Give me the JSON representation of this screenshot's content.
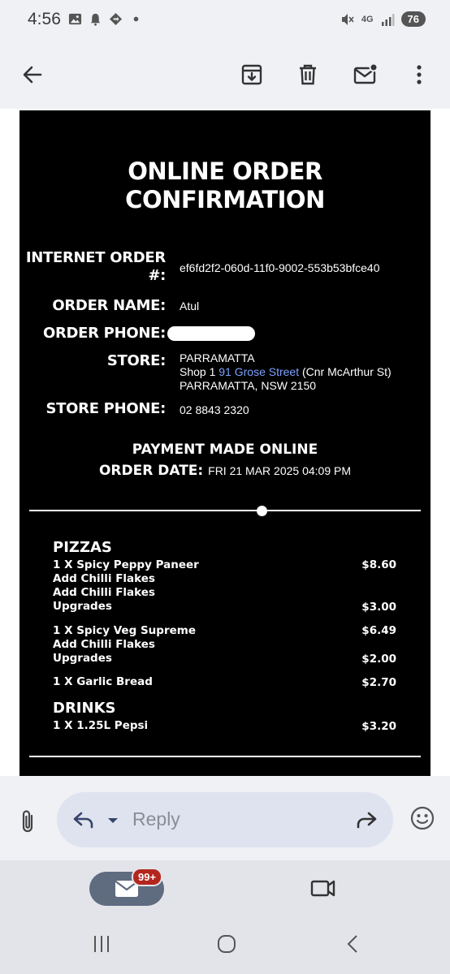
{
  "status_bar": {
    "time": "4:56",
    "network": "4G",
    "battery": "76",
    "icons": [
      "gallery-icon",
      "notification-icon",
      "location-icon",
      "more-dot-icon",
      "mute-icon",
      "signal-icon"
    ]
  },
  "app_bar": {
    "icons": [
      "back-arrow-icon",
      "archive-icon",
      "delete-icon",
      "mark-unread-icon",
      "more-vert-icon"
    ]
  },
  "receipt": {
    "title_line1": "ONLINE ORDER",
    "title_line2": "CONFIRMATION",
    "order_number_label_1": "INTERNET ORDER",
    "order_number_label_2": "#:",
    "order_number": "ef6fd2f2-060d-11f0-9002-553b53bfce40",
    "order_name_label": "ORDER NAME:",
    "order_name": "Atul",
    "order_phone_label": "ORDER PHONE:",
    "store_label": "STORE:",
    "store_name": "PARRAMATTA",
    "store_addr_prefix": "Shop 1 ",
    "store_addr_link": "91 Grose Street",
    "store_addr_suffix": " (Cnr McArthur St)",
    "store_city": "PARRAMATTA, NSW 2150",
    "store_phone_label": "STORE PHONE:",
    "store_phone": "02 8843 2320",
    "payment": "PAYMENT MADE ONLINE",
    "order_date_label": "ORDER DATE:",
    "order_date": "FRI 21 MAR 2025 04:09 PM",
    "pizzas_heading": "PIZZAS",
    "items": [
      {
        "text": "1 X Spicy Peppy Paneer",
        "price": "$8.60"
      },
      {
        "text": "Add Chilli Flakes",
        "price": ""
      },
      {
        "text": "Add Chilli Flakes",
        "price": ""
      },
      {
        "text": "Upgrades",
        "price": "$3.00"
      },
      {
        "text": "1 X Spicy Veg Supreme",
        "price": "$6.49"
      },
      {
        "text": "Add Chilli Flakes",
        "price": ""
      },
      {
        "text": "Upgrades",
        "price": "$2.00"
      },
      {
        "text": "1 X Garlic Bread",
        "price": "$2.70"
      }
    ],
    "drinks_heading": "DRINKS",
    "drinks": [
      {
        "text": "1 X 1.25L Pepsi",
        "price": "$3.20"
      }
    ]
  },
  "reply_bar": {
    "placeholder": "Reply"
  },
  "bottom_nav": {
    "mail_badge": "99+"
  }
}
